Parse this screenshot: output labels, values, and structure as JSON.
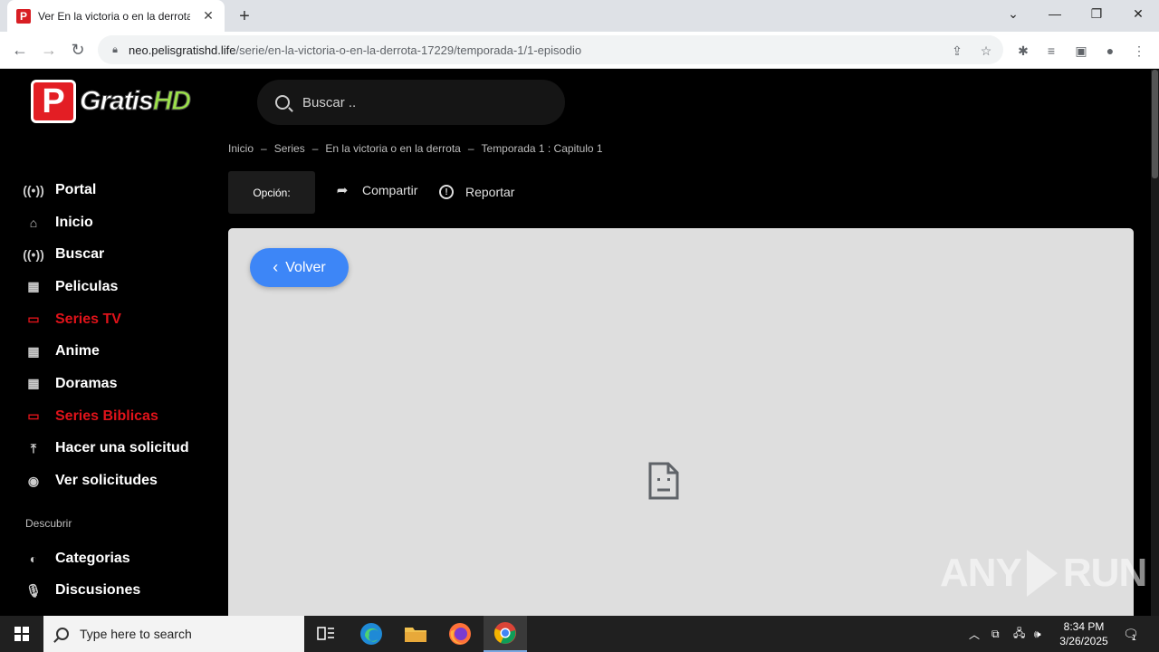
{
  "browser": {
    "tab_title": "Ver En la victoria o en la derrota",
    "url_host": "neo.pelisgratishd.life",
    "url_path": "/serie/en-la-victoria-o-en-la-derrota-17229/temporada-1/1-episodio"
  },
  "site": {
    "logo_letter": "P",
    "logo_text_1": "Gratis",
    "logo_text_2": "HD",
    "search_placeholder": "Buscar .."
  },
  "sidebar": {
    "items": [
      {
        "label": "Portal",
        "icon": "broadcast-icon"
      },
      {
        "label": "Inicio",
        "icon": "home-icon"
      },
      {
        "label": "Buscar",
        "icon": "broadcast-icon"
      },
      {
        "label": "Peliculas",
        "icon": "film-icon"
      },
      {
        "label": "Series TV",
        "icon": "tv-icon"
      },
      {
        "label": "Anime",
        "icon": "film-icon"
      },
      {
        "label": "Doramas",
        "icon": "film-icon"
      },
      {
        "label": "Series Biblicas",
        "icon": "tv-icon"
      },
      {
        "label": "Hacer una solicitud",
        "icon": "upload-icon"
      },
      {
        "label": "Ver solicitudes",
        "icon": "eye-icon"
      }
    ],
    "section_label": "Descubrir",
    "discover_items": [
      {
        "label": "Categorias",
        "icon": "half-circle-icon"
      },
      {
        "label": "Discusiones",
        "icon": "microphone-icon"
      }
    ],
    "accent_color": "#e0131a"
  },
  "breadcrumb": {
    "items": [
      "Inicio",
      "Series",
      "En la victoria o en la derrota",
      "Temporada 1 : Capitulo 1"
    ],
    "separator": "–"
  },
  "actions": {
    "option_label": "Opción:",
    "share_label": "Compartir",
    "report_label": "Reportar"
  },
  "player": {
    "back_label": "Volver",
    "back_color": "#3d86f7",
    "status_icon": "broken-file-icon"
  },
  "watermark": {
    "text_1": "ANY",
    "text_2": "RUN"
  },
  "taskbar": {
    "search_placeholder": "Type here to search",
    "time": "8:34 PM",
    "date": "3/26/2025",
    "notification_count": "1"
  }
}
